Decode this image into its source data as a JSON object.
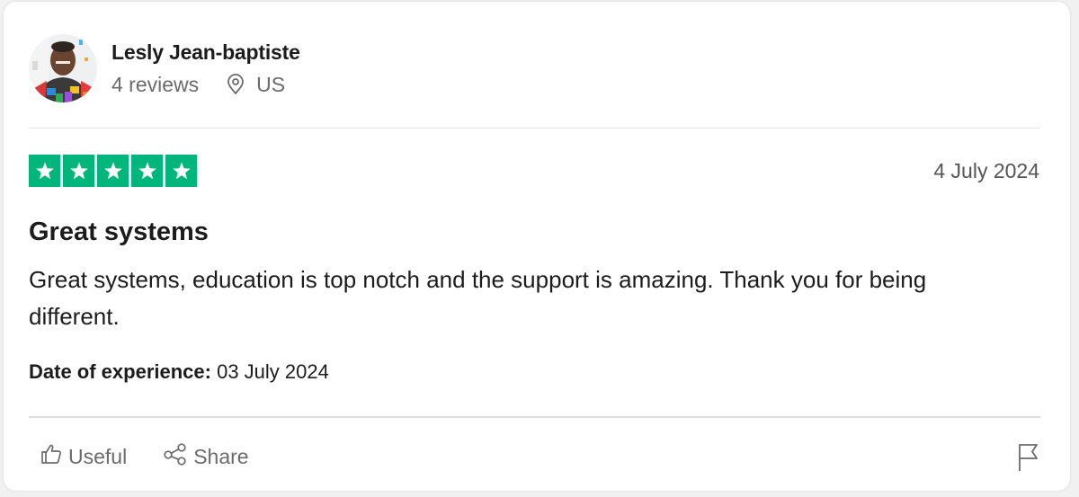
{
  "reviewer": {
    "name": "Lesly Jean-baptiste",
    "review_count": "4 reviews",
    "location": "US"
  },
  "review": {
    "rating": 5,
    "rating_max": 5,
    "star_color": "#00b67a",
    "date": "4 July 2024",
    "title": "Great systems",
    "body": "Great systems, education is top notch and the support is amazing. Thank you for being different.",
    "experience_label": "Date of experience:",
    "experience_date": "03 July 2024"
  },
  "actions": {
    "useful_label": "Useful",
    "share_label": "Share"
  },
  "icons": {
    "location": "location-pin-icon",
    "useful": "thumbs-up-icon",
    "share": "share-icon",
    "report": "flag-icon"
  }
}
